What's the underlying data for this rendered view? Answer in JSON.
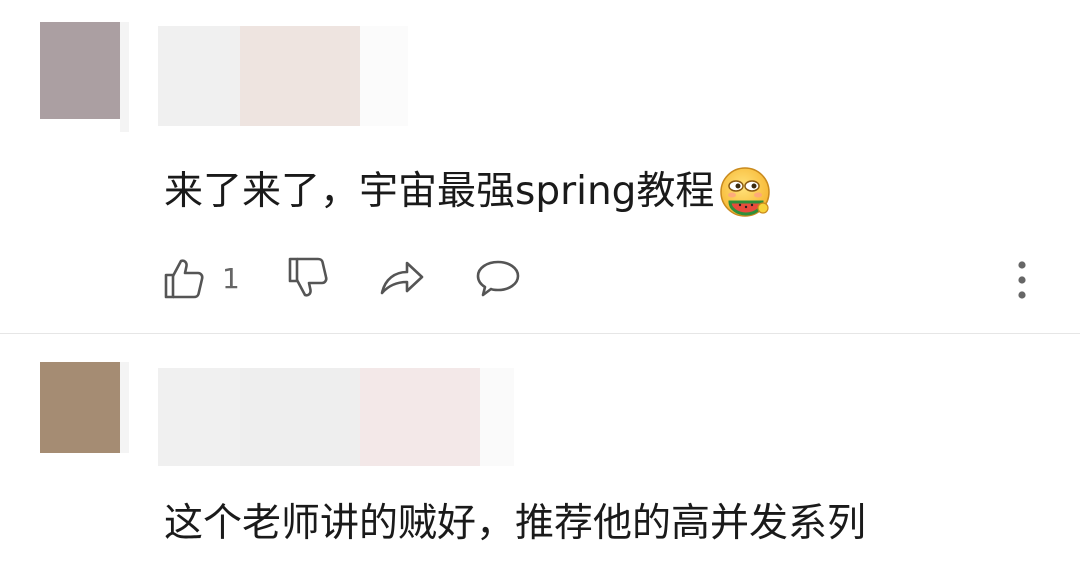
{
  "comments": [
    {
      "avatar_color": "#ab9fa2",
      "name_blur_colors": [
        "#f0f0f0",
        "#eee4e0",
        "#fbfbfb"
      ],
      "text": "来了来了，宇宙最强spring教程",
      "emoji_icon": "watermelon-face-emoji-icon",
      "likes": "1"
    },
    {
      "avatar_color": "#a58c73",
      "name_blur_colors": [
        "#f0f0f0",
        "#eeeeee",
        "#f3e8e8",
        "#fafafa"
      ],
      "text": "这个老师讲的贼好，推荐他的高并发系列"
    }
  ],
  "icons": {
    "like": "thumbs-up-icon",
    "dislike": "thumbs-down-icon",
    "share": "share-arrow-icon",
    "reply": "comment-bubble-icon",
    "more": "more-vertical-icon"
  },
  "colors": {
    "icon_stroke": "#555555",
    "divider": "#e6e6e6",
    "text": "#1a1a1a"
  }
}
